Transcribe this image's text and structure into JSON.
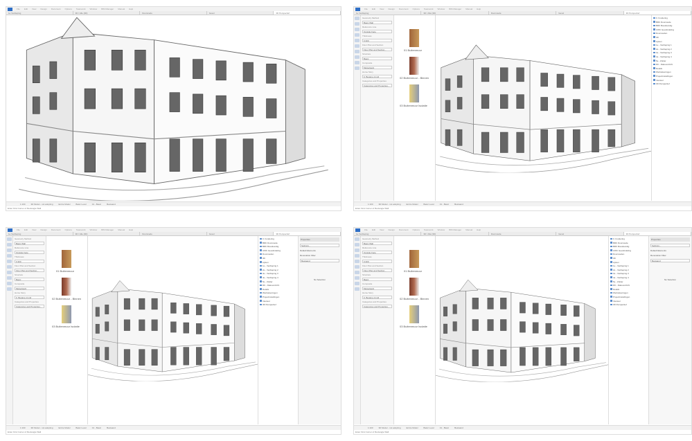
{
  "menu": [
    "File",
    "Edit",
    "View",
    "Design",
    "Document",
    "Options",
    "Teamwork",
    "Window",
    "BIM Manager",
    "Manual",
    "Help"
  ],
  "tabs": [
    "1e Verdieping",
    "3D / Alle (3D)",
    "Doorsnede",
    "Gevel",
    "3D Perspectief"
  ],
  "bottom": {
    "scale": "1:100",
    "model_view": "3D Model - not adopting",
    "layer": "Entire Model",
    "level": "Basic Level",
    "pen_set": "01 - Basic",
    "renovation": "Bestaand"
  },
  "status": "Enter First Corner of Rectangle Wall",
  "infobox": {
    "labels": [
      "Geometry Method",
      "Reference Line",
      "Thickness",
      "Floor Plan and Section",
      "Structure",
      "Composite",
      "Home Story",
      "Categories and Properties"
    ],
    "values": [
      "Basic Wall",
      "Outside Face",
      "0,300",
      "Floor Plan and Section...",
      "Basic",
      "Metselwerk",
      "0. Begane grond",
      "Categories and Properties..."
    ]
  },
  "navigator": {
    "items": [
      "0. Fundering",
      "BRK Doorsnede",
      "BRK Bouwkundig",
      "UWK Gevelindeling",
      "Doorsneden",
      "3D",
      "Lijsten",
      "1e - Verdieping 1",
      "2e - Verdieping 2",
      "3e - Verdieping 3",
      "4e - Verdieping 4",
      "5e - Zolder",
      "DK - Dakoverzicht",
      "Details",
      "Werktekeningen",
      "Projectinstellingen",
      "Interieur",
      "3D Perspectief"
    ]
  },
  "properties": {
    "title": "Properties",
    "selection": "No Selection",
    "settings": "Settings...",
    "pane_title": "Default Elements",
    "renovation": "Renovation Filter"
  },
  "favorites": [
    "01 Buitenmuur",
    "02 Buitenmuur - Binnen",
    "03 Buitenmuur Isolatie"
  ],
  "colors": {
    "accent": "#2f6fc7",
    "brick": "#a0643a",
    "wood": "#c79a5a"
  }
}
